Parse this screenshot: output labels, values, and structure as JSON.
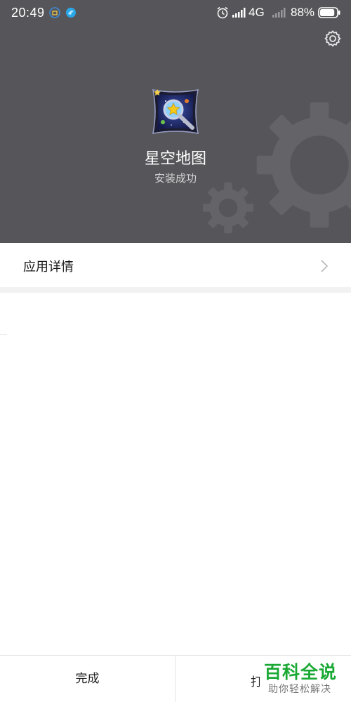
{
  "status_bar": {
    "time": "20:49",
    "network_type": "4G",
    "battery_percent": "88%",
    "battery_level": 0.88,
    "icons": [
      "app-notification-icon",
      "bird-notification-icon",
      "alarm-icon",
      "signal-icon",
      "battery-icon"
    ]
  },
  "header": {
    "background_color": "#56565a",
    "settings_icon": "gear-icon",
    "app_icon": "star-map-app-icon",
    "app_name": "星空地图",
    "install_status": "安装成功"
  },
  "details": {
    "label": "应用详情",
    "chevron_icon": "chevron-right-icon"
  },
  "bottom_bar": {
    "done_label": "完成",
    "open_label": "打"
  },
  "watermark": {
    "main": "百科全说",
    "sub": "助你轻松解决",
    "color": "#1aa934"
  }
}
